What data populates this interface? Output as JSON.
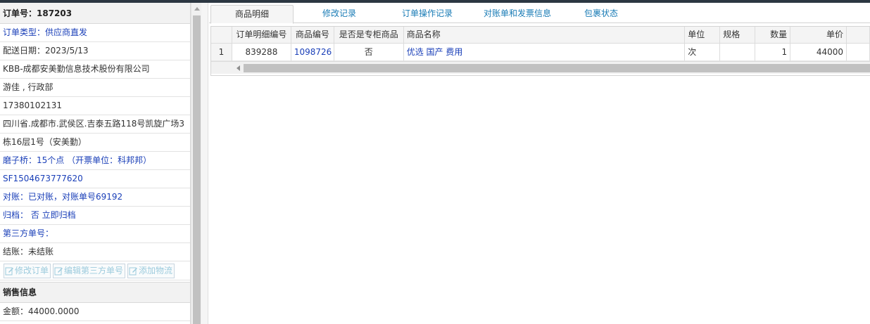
{
  "order": {
    "header": "订单号：187203",
    "rows": [
      {
        "text": "订单类型：供应商直发",
        "blue": true
      },
      {
        "text": "配送日期：2023/5/13",
        "blue": false
      },
      {
        "text": "KBB-成都安美勤信息技术股份有限公司",
        "blue": false
      },
      {
        "text": "游佳 , 行政部",
        "blue": false
      },
      {
        "text": "17380102131",
        "blue": false
      },
      {
        "text": "四川省.成都市.武侯区.吉泰五路118号凯旋广场3",
        "blue": false
      },
      {
        "text": "栋16层1号（安美勤）",
        "blue": false
      },
      {
        "text": "磨子桥：15个点 （开票单位：科邦邦）",
        "blue": true
      },
      {
        "text": "SF1504673777620",
        "blue": true
      },
      {
        "text": "对账：已对账，对账单号69192",
        "blue": true
      },
      {
        "text": "归档： 否 立即归档",
        "blue": true
      },
      {
        "text": "第三方单号：",
        "blue": true
      },
      {
        "text": "结账：未结账",
        "blue": false
      }
    ],
    "buttons": {
      "edit_order": "修改订单",
      "edit_third_party": "编辑第三方单号",
      "add_logistics": "添加物流"
    }
  },
  "sales": {
    "header": "销售信息",
    "amount": "金额：44000.0000"
  },
  "tabs": [
    "商品明细",
    "修改记录",
    "订单操作记录",
    "对账单和发票信息",
    "包裹状态"
  ],
  "grid": {
    "columns": [
      "",
      "订单明细编号",
      "商品编号",
      "是否是专柜商品",
      "商品名称",
      "单位",
      "规格",
      "数量",
      "单价"
    ],
    "rows": [
      {
        "idx": "1",
        "detail_no": "839288",
        "product_no": "1098726",
        "counter": "否",
        "name": "优选 国产 费用",
        "unit": "次",
        "spec": "",
        "qty": "1",
        "price": "44000"
      }
    ]
  },
  "colors": {
    "link": "#1a3fb8",
    "tab": "#1a7cb6",
    "button_text": "#9ccbdd"
  },
  "icons": {
    "button": "edit-icon"
  }
}
